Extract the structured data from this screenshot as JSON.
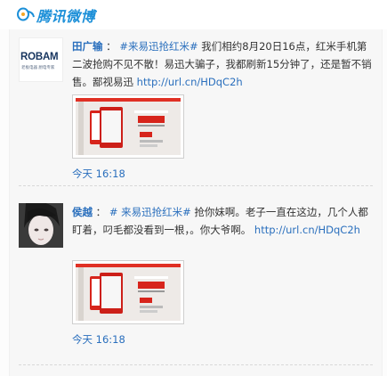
{
  "app": {
    "logo_text": "腾讯微博",
    "logo_icon": "qq-penguin-icon"
  },
  "posts": [
    {
      "author": "田广输",
      "colon": "：",
      "topic": "#来易迅抢红米#",
      "body": "我们相约8月20日16点，红米手机第二波抢购不见不散！易迅大骗子，我都刷新15分钟了，还是暂不销售。鄙视易迅",
      "link": "http://url.cn/HDqC2h",
      "time": "今天 16:18",
      "avatar_text": "ROBAM",
      "avatar_sub": "老板电器 厨电专家"
    },
    {
      "author": "侯越",
      "colon": "：",
      "topic": "# 来易迅抢红米#",
      "body": "抢你妹啊。老子一直在这边，几个人都盯着，叼毛都没看到一根，。你大爷啊。",
      "link": "http://url.cn/HDqC2h",
      "time": "今天 16:18"
    }
  ],
  "colors": {
    "link_blue": "#2a6fbd",
    "logo_blue": "#1b8fd8",
    "promo_red": "#d7241b"
  }
}
